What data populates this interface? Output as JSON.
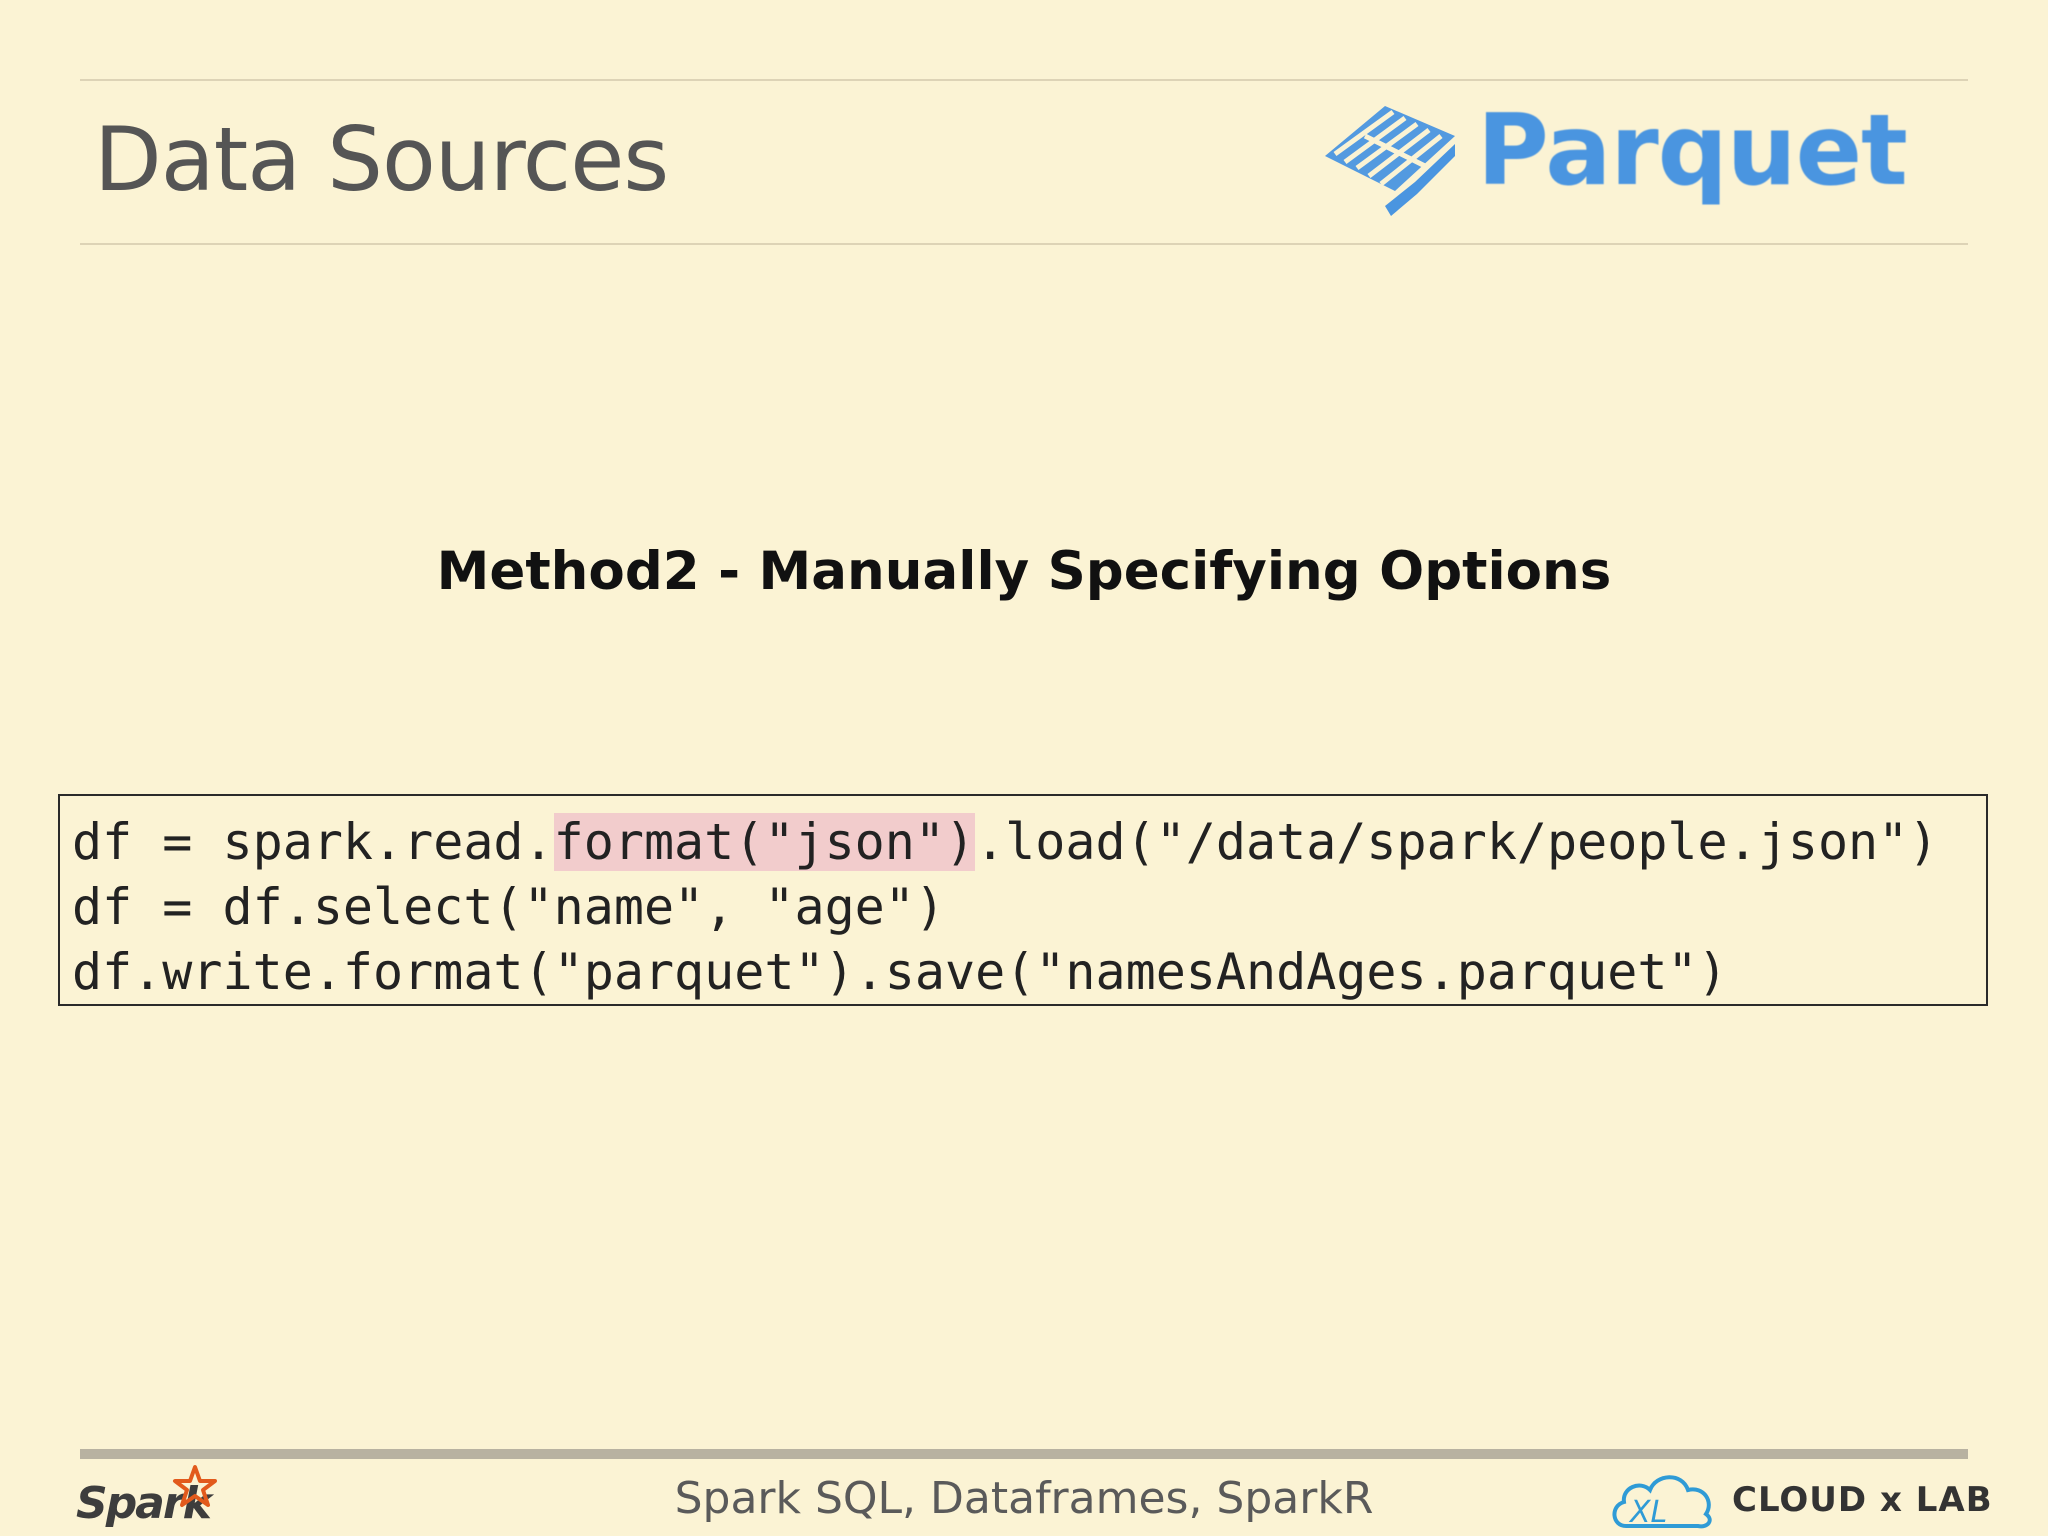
{
  "slide": {
    "title": "Data Sources",
    "heading": "Method2 - Manually Specifying Options"
  },
  "logos": {
    "parquet_text": "Parquet",
    "spark_text": "Spark",
    "cloudxlab_text": "CLOUD x LAB"
  },
  "code": {
    "line1_pre": "df = spark.read.",
    "line1_highlight": "format(\"json\")",
    "line1_post": ".load(\"/data/spark/people.json\")",
    "line2": "df = df.select(\"name\", \"age\")",
    "line3": "df.write.format(\"parquet\").save(\"namesAndAges.parquet\")"
  },
  "footer": {
    "title": "Spark SQL, Dataframes, SparkR"
  },
  "colors": {
    "background": "#fbf3d4",
    "parquet_blue": "#4a95e0",
    "highlight": "#f2cccc",
    "spark_orange": "#e25a1c"
  }
}
